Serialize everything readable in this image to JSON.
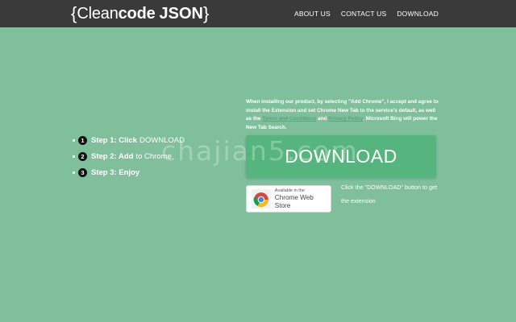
{
  "header": {
    "logo": {
      "open_brace": "{",
      "clean": "Clean",
      "code": "code",
      "json": "JSON",
      "close_brace": "}"
    },
    "nav": [
      "ABOUT US",
      "CONTACT US",
      "DOWNLOAD"
    ]
  },
  "steps": [
    {
      "number": "1",
      "bold": "Step 1: Click",
      "plain": "DOWNLOAD"
    },
    {
      "number": "2",
      "bold": "Step 2: Add",
      "plain": "to Chrome"
    },
    {
      "number": "3",
      "bold": "Step 3: Enjoy",
      "plain": ""
    }
  ],
  "disclaimer": {
    "part1": "When installing our product, by selecting \"Add Chrome\", I accept and agree to install the Extension and set Chrome New Tab to the service's default, as well as the",
    "terms_link": "Terms and Conditions",
    "and": "and",
    "privacy_link": "Privacy Policy",
    "part2": ". Microsoft Bing will power the New Tab Search."
  },
  "download_button": "DOWNLOAD",
  "web_store_badge": {
    "small": "Available in the",
    "big": "Chrome Web Store"
  },
  "hint": "Click the \"DOWNLOAD\" button to get the extension",
  "watermark": "chajian5.com",
  "colors": {
    "background": "#7fbf9c",
    "topbar": "#3a3a3a",
    "button": "#56b57e"
  }
}
